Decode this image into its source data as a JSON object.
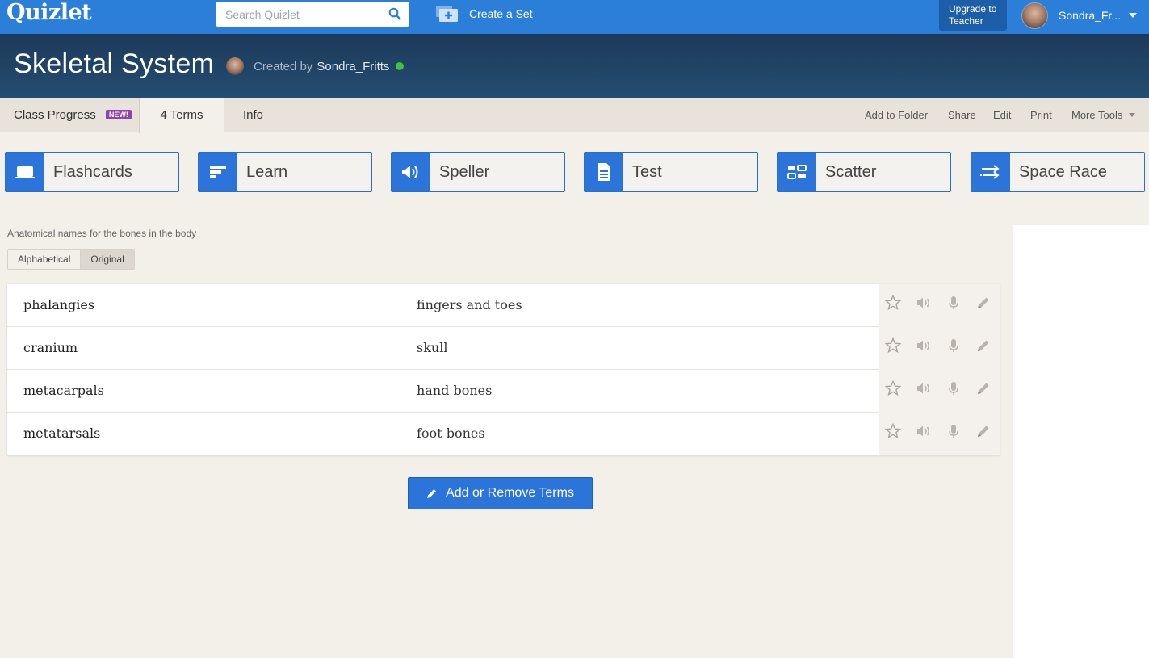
{
  "brand": {
    "logo": "Quizlet"
  },
  "topbar": {
    "search_placeholder": "Search Quizlet",
    "create_set_label": "Create a Set",
    "upgrade_line1": "Upgrade to",
    "upgrade_line2": "Teacher",
    "username": "Sondra_Fr..."
  },
  "header": {
    "title": "Skeletal System",
    "created_by_prefix": "Created by",
    "creator": "Sondra_Fritts"
  },
  "tabs": {
    "class_progress": "Class Progress",
    "new_badge": "NEW!",
    "terms": "4 Terms",
    "info": "Info"
  },
  "tools": [
    "Add to Folder",
    "Share",
    "Edit",
    "Print",
    "More Tools"
  ],
  "modes": [
    {
      "label": "Flashcards",
      "icon": "flashcards-icon"
    },
    {
      "label": "Learn",
      "icon": "learn-icon"
    },
    {
      "label": "Speller",
      "icon": "speaker-icon"
    },
    {
      "label": "Test",
      "icon": "document-icon"
    },
    {
      "label": "Scatter",
      "icon": "scatter-icon"
    },
    {
      "label": "Space Race",
      "icon": "space-race-icon"
    }
  ],
  "description": "Anatomical names for the bones in the body",
  "sort": {
    "alphabetical": "Alphabetical",
    "original": "Original",
    "selected": "Original"
  },
  "terms": [
    {
      "term": "phalangies",
      "definition": "fingers and toes"
    },
    {
      "term": "cranium",
      "definition": "skull"
    },
    {
      "term": "metacarpals",
      "definition": "hand bones"
    },
    {
      "term": "metatarsals",
      "definition": "foot bones"
    }
  ],
  "add_remove_label": "Add or Remove Terms",
  "colors": {
    "brand_blue": "#2b7fd9",
    "header_navy": "#1c3a59",
    "online_green": "#3fc33f",
    "badge_purple": "#8e44ad"
  }
}
